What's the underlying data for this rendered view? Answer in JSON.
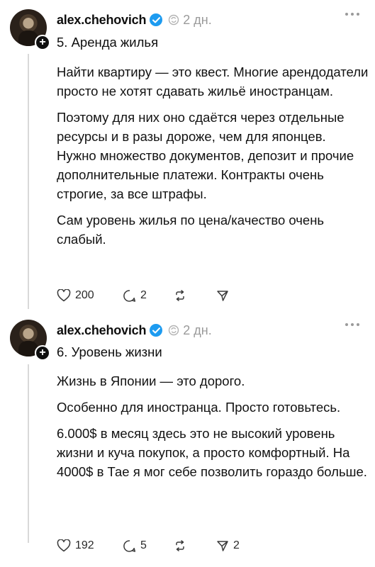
{
  "posts": [
    {
      "username": "alex.chehovich",
      "time": "2 дн.",
      "subtitle": "5. Аренда жилья",
      "paragraphs": [
        "Найти квартиру — это квест. Многие арендодатели просто не хотят сдавать жильё иностранцам.",
        "Поэтому для них оно сдаётся через отдельные ресурсы и в разы дороже, чем для японцев. Нужно множество документов, депозит и прочие дополнительные платежи. Контракты очень строгие, за все штрафы.",
        "Сам уровень жилья по цена/качество очень слабый."
      ],
      "likes": "200",
      "replies": "2",
      "reposts": "",
      "shares": ""
    },
    {
      "username": "alex.chehovich",
      "time": "2 дн.",
      "subtitle": "6. Уровень жизни",
      "paragraphs": [
        "Жизнь в Японии — это дорого.",
        "Особенно для иностранца. Просто готовьтесь.",
        "6.000$ в месяц здесь это не высокий уровень жизни и куча покупок, а просто комфортный. На 4000$ в Тае я мог себе позволить гораздо больше."
      ],
      "likes": "192",
      "replies": "5",
      "reposts": "",
      "shares": "2"
    }
  ],
  "icons": {
    "verified": "verified-badge-icon",
    "repost_small": "repost-icon",
    "more": "more-dots-icon",
    "like": "heart-icon",
    "reply": "comment-icon",
    "repost": "repost-icon",
    "share": "send-icon",
    "follow": "plus-icon"
  },
  "colors": {
    "verified": "#1d9bf0",
    "text": "#121212",
    "muted": "#9a9a9a"
  }
}
